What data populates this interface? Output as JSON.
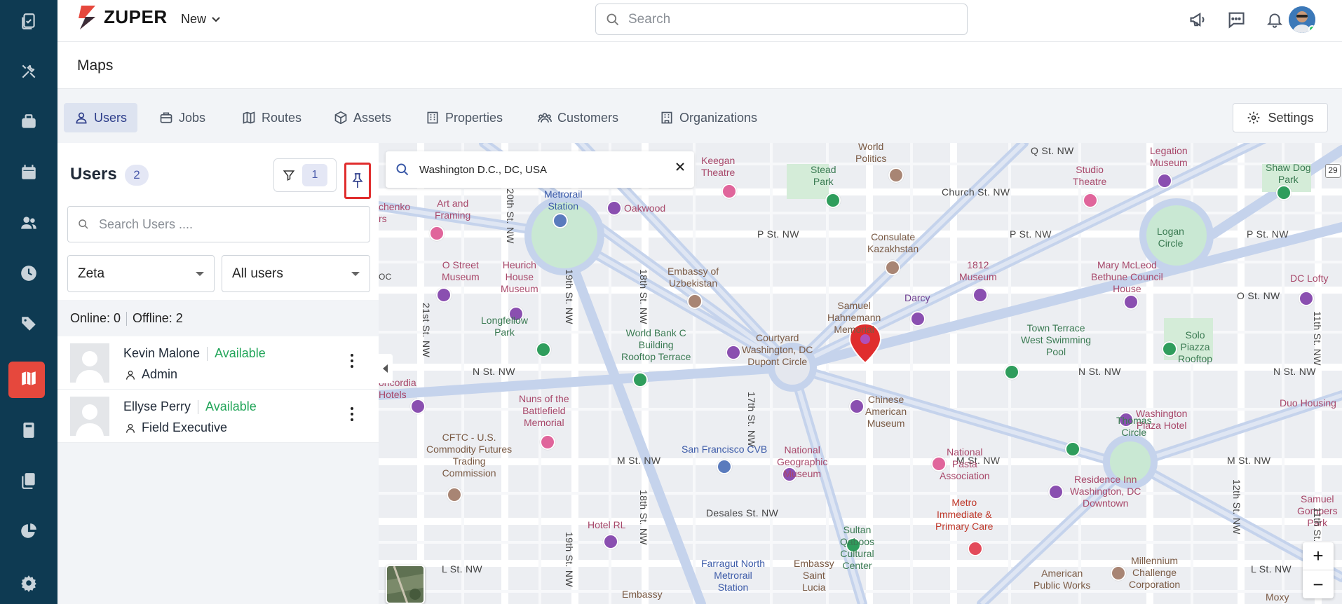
{
  "app": {
    "brand": "ZUPER",
    "new_label": "New",
    "search_placeholder": "Search"
  },
  "page": {
    "title": "Maps"
  },
  "tabs": [
    {
      "label": "Users",
      "icon": "user-icon",
      "active": true
    },
    {
      "label": "Jobs",
      "icon": "briefcase-icon",
      "active": false
    },
    {
      "label": "Routes",
      "icon": "map-icon",
      "active": false
    },
    {
      "label": "Assets",
      "icon": "cube-icon",
      "active": false
    },
    {
      "label": "Properties",
      "icon": "building-icon",
      "active": false
    },
    {
      "label": "Customers",
      "icon": "users-icon",
      "active": false
    },
    {
      "label": "Organizations",
      "icon": "organization-icon",
      "active": false
    }
  ],
  "settings_label": "Settings",
  "users_panel": {
    "title": "Users",
    "count": "2",
    "filter_count": "1",
    "search_placeholder": "Search Users ....",
    "team_select": "Zeta",
    "status_select": "All users",
    "online": "Online: 0",
    "offline": "Offline: 2",
    "users": [
      {
        "name": "Kevin Malone",
        "status": "Available",
        "role": "Admin"
      },
      {
        "name": "Ellyse Perry",
        "status": "Available",
        "role": "Field Executive"
      }
    ]
  },
  "map": {
    "search_value": "Washington D.C., DC, USA",
    "zoom_in": "+",
    "zoom_out": "−",
    "labels": {
      "world_politics": "World\nPolitics",
      "keegan": "Keegan\nTheatre",
      "stead_park": "Stead\nPark",
      "church_st": "Church St. NW",
      "studio_theatre": "Studio\nTheatre",
      "q_st": "Q St. NW",
      "legation_museum": "Legation\nMuseum",
      "shaw_dog_park": "Shaw Dog\nPark",
      "art_framing": "Art and\nFraming",
      "chenko": "chenko\nrs",
      "metrorail": "Metrorail\nStation",
      "oakwood": "Oakwood",
      "p_st_1": "P St. NW",
      "p_st_2": "P St. NW",
      "p_st_3": "P St. NW",
      "consulate": "Consulate\nKazakhstan",
      "logan_circle": "Logan\nCircle",
      "o_street_museum": "O Street\nMuseum",
      "heurich": "Heurich\nHouse\nMuseum",
      "embassy_uzbek": "Embassy of\nUzbekistan",
      "museum_1812": "1812\nMuseum",
      "mary_mcleod": "Mary McLeod\nBethune Council\nHouse",
      "dc_lofty": "DC Lofty",
      "o_st": "O St. NW",
      "darcy": "Darcy",
      "samuel": "Samuel\nHahnemann\nMemorial",
      "longfellow": "Longfellow\nPark",
      "world_bank": "World Bank C\nBuilding\nRooftop Terrace",
      "courtyard": "Courtyard\nWashington, DC\nDupont Circle",
      "town_terrace": "Town Terrace\nWest Swimming\nPool",
      "solo_piazza": "Solo\nPiazza\nRooftop",
      "n_st_1": "N St. NW",
      "n_st_2": "N St. NW",
      "n_st_3": "N St. NW",
      "concordia": "oncordia\nHotels",
      "nuns": "Nuns of the\nBattlefield\nMemorial",
      "chinese_museum": "Chinese\nAmerican\nMuseum",
      "thomas_circle": "Thomas\nCircle",
      "washington_plaza": "Washington\nPlaza Hotel",
      "duo_housing": "Duo Housing",
      "cftc": "CFTC - U.S.\nCommodity Futures\nTrading\nCommission",
      "sf_cvb": "San Francisco CVB",
      "m_st_1": "M St. NW",
      "m_st_2": "M St. NW",
      "m_st_3": "M St. NW",
      "nat_geo": "National\nGeographic\nMuseum",
      "nat_pasta": "National\nPasta\nAssociation",
      "residence_inn": "Residence Inn\nWashington, DC\nDowntown",
      "samuel_gompers": "Samuel\nGompers\nPark",
      "desales": "Desales St. NW",
      "metro_immediate": "Metro\nImmediate &\nPrimary Care",
      "hotel_rl": "Hotel RL",
      "sultan": "Sultan\nQaboos\nCultural\nCenter",
      "farragut": "Farragut North\nMetrorail\nStation",
      "embassy_lucia": "Embassy\nSaint\nLucia",
      "millennium": "Millennium\nChallenge\nCorporation",
      "american_pw": "American\nPublic Works",
      "l_st_1": "L St. NW",
      "l_st_2": "L St. NW",
      "embassy_bottom": "Embassy",
      "st_20": "20th St. NW",
      "st_21": "21st St. NW",
      "st_19": "19th St. NW",
      "st_18": "18th St. NW",
      "st_17": "17th St. NW",
      "st_11": "11th St. NW",
      "st_12": "12th St. NW",
      "route_29": "29",
      "oc": "OC",
      "moxy": "Moxy"
    }
  },
  "colors": {
    "rail": "#0e3a52",
    "rail_active": "#e6483d",
    "accent": "#2d3d8a",
    "available": "#22a559",
    "pin_border": "#e02d2d",
    "map_marker": "#e02d2d"
  }
}
